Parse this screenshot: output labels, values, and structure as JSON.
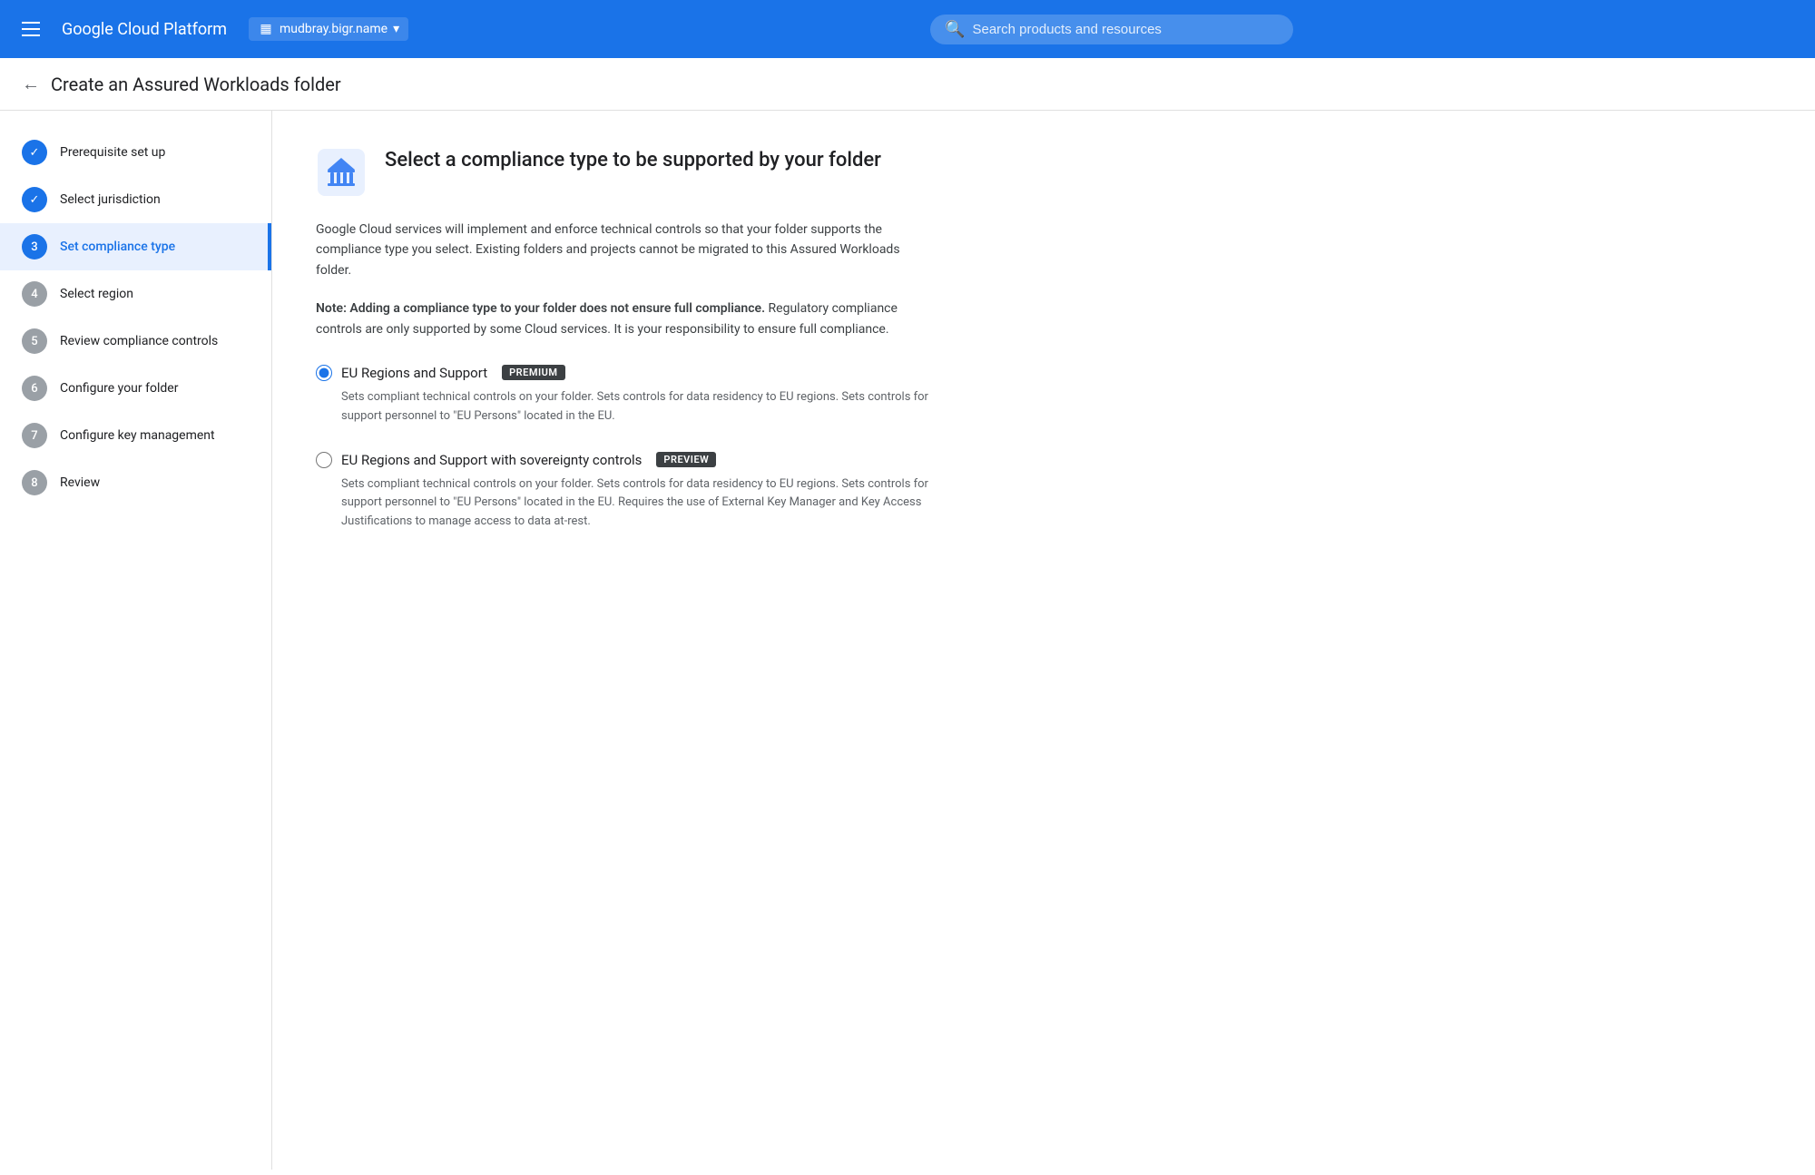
{
  "topNav": {
    "hamburger_aria": "Main menu",
    "logo": "Google Cloud Platform",
    "project_icon": "▦",
    "project_name": "mudbray.bigr.name",
    "project_dropdown_icon": "▾",
    "search_placeholder": "Search products and resources"
  },
  "pageHeader": {
    "back_aria": "Back",
    "title": "Create an Assured Workloads folder"
  },
  "sidebar": {
    "steps": [
      {
        "number": "✓",
        "label": "Prerequisite set up",
        "state": "completed"
      },
      {
        "number": "✓",
        "label": "Select jurisdiction",
        "state": "completed"
      },
      {
        "number": "3",
        "label": "Set compliance type",
        "state": "current"
      },
      {
        "number": "4",
        "label": "Select region",
        "state": "pending"
      },
      {
        "number": "5",
        "label": "Review compliance controls",
        "state": "pending"
      },
      {
        "number": "6",
        "label": "Configure your folder",
        "state": "pending"
      },
      {
        "number": "7",
        "label": "Configure key management",
        "state": "pending"
      },
      {
        "number": "8",
        "label": "Review",
        "state": "pending"
      }
    ]
  },
  "content": {
    "icon_aria": "Compliance icon",
    "title": "Select a compliance type to be supported by your folder",
    "description": "Google Cloud services will implement and enforce technical controls so that your folder supports the compliance type you select. Existing folders and projects cannot be migrated to this Assured Workloads folder.",
    "note_bold": "Note: Adding a compliance type to your folder does not ensure full compliance.",
    "note_rest": " Regulatory compliance controls are only supported by some Cloud services. It is your responsibility to ensure full compliance.",
    "options": [
      {
        "id": "opt1",
        "label": "EU Regions and Support",
        "badge": "PREMIUM",
        "badge_type": "premium",
        "checked": true,
        "description": "Sets compliant technical controls on your folder. Sets controls for data residency to EU regions. Sets controls for support personnel to \"EU Persons\" located in the EU."
      },
      {
        "id": "opt2",
        "label": "EU Regions and Support with sovereignty controls",
        "badge": "PREVIEW",
        "badge_type": "preview",
        "checked": false,
        "description": "Sets compliant technical controls on your folder. Sets controls for data residency to EU regions. Sets controls for support personnel to \"EU Persons\" located in the EU. Requires the use of External Key Manager and Key Access Justifications to manage access to data at-rest."
      }
    ]
  }
}
